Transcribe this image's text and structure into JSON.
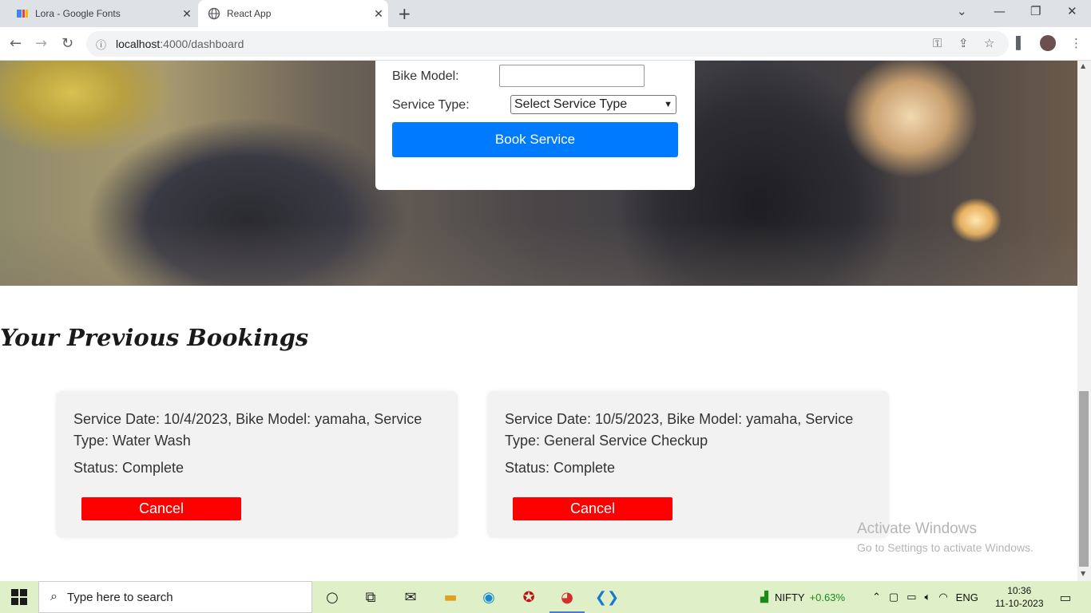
{
  "browser": {
    "tabs": [
      {
        "title": "Lora - Google Fonts",
        "favicon": "google-fonts-icon",
        "active": false
      },
      {
        "title": "React App",
        "favicon": "globe-icon",
        "active": true
      }
    ],
    "url_host": "localhost",
    "url_rest": ":4000/dashboard"
  },
  "booking_form": {
    "bike_model_label": "Bike Model:",
    "bike_model_value": "",
    "service_type_label": "Service Type:",
    "service_type_selected": "Select Service Type",
    "book_button": "Book Service",
    "button_color": "#007bff"
  },
  "previous": {
    "title": "Your Previous Bookings",
    "bookings": [
      {
        "description": "Service Date: 10/4/2023, Bike Model: yamaha, Service Type: Water Wash",
        "status": "Status: Complete",
        "cancel_label": "Cancel"
      },
      {
        "description": "Service Date: 10/5/2023, Bike Model: yamaha, Service Type: General Service Checkup",
        "status": "Status: Complete",
        "cancel_label": "Cancel"
      }
    ],
    "cancel_color": "#ff0000"
  },
  "watermark": {
    "line1": "Activate Windows",
    "line2": "Go to Settings to activate Windows."
  },
  "taskbar": {
    "search_placeholder": "Type here to search",
    "nifty_label": "NIFTY",
    "nifty_change": "+0.63%",
    "language": "ENG",
    "time": "10:36",
    "date": "11-10-2023"
  }
}
